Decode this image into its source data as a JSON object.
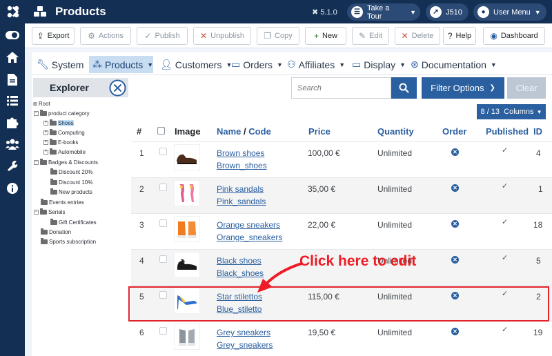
{
  "header": {
    "title": "Products",
    "version": "5.1.0",
    "tour_label": "Take a Tour",
    "site_label": "J510",
    "user_label": "User Menu"
  },
  "toolbar": {
    "export": "Export",
    "actions": "Actions",
    "publish": "Publish",
    "unpublish": "Unpublish",
    "copy": "Copy",
    "new": "New",
    "edit": "Edit",
    "delete": "Delete",
    "help": "Help",
    "dashboard": "Dashboard"
  },
  "menu": {
    "system": "System",
    "products": "Products",
    "customers": "Customers",
    "orders": "Orders",
    "affiliates": "Affiliates",
    "display": "Display",
    "documentation": "Documentation"
  },
  "explorer": {
    "title": "Explorer",
    "tree": [
      "Root",
      "product category",
      "Shoes",
      "Computing",
      "E-books",
      "Automobile",
      "Badges & Discounts",
      "Discount 20%",
      "Discount 10%",
      "New products",
      "Events entries",
      "Serials",
      "Gift Certificates",
      "Donation",
      "Sports subscription"
    ]
  },
  "filters": {
    "search_placeholder": "Search",
    "filter_options": "Filter Options",
    "clear": "Clear",
    "columns": "8 / 13  Columns"
  },
  "table": {
    "headers": {
      "num": "#",
      "image": "Image",
      "name": "Name",
      "slash": "/",
      "code": "Code",
      "price": "Price",
      "quantity": "Quantity",
      "order": "Order",
      "published": "Published",
      "id": "ID"
    },
    "rows": [
      {
        "num": "1",
        "name": "Brown shoes",
        "code": "Brown_shoes",
        "price": "100,00 €",
        "quantity": "Unlimited",
        "id": "4"
      },
      {
        "num": "2",
        "name": "Pink sandals",
        "code": "Pink_sandals",
        "price": "35,00 €",
        "quantity": "Unlimited",
        "id": "1"
      },
      {
        "num": "3",
        "name": "Orange sneakers",
        "code": "Orange_sneakers",
        "price": "22,00 €",
        "quantity": "Unlimited",
        "id": "18"
      },
      {
        "num": "4",
        "name": "Black shoes",
        "code": "Black_shoes",
        "price": "",
        "quantity": "Unlimited",
        "id": "5"
      },
      {
        "num": "5",
        "name": "Star stilettos",
        "code": "Blue_stiletto",
        "price": "115,00 €",
        "quantity": "Unlimited",
        "id": "2"
      },
      {
        "num": "6",
        "name": "Grey sneakers",
        "code": "Grey_sneakers",
        "price": "19,50 €",
        "quantity": "Unlimited",
        "id": "19"
      }
    ]
  },
  "annotation": {
    "text": "Click here to edit",
    "color": "#ee1c24"
  },
  "colors": {
    "header_bg": "#132f53",
    "primary": "#2a5fa0",
    "menu_active": "#c8ddf1"
  }
}
